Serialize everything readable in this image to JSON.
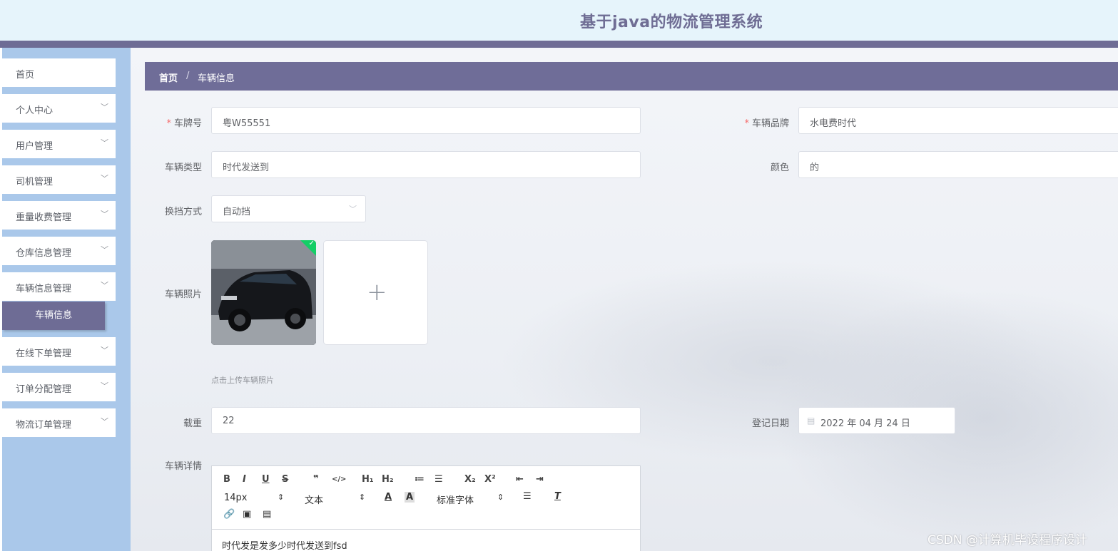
{
  "app_title": "基于java的物流管理系统",
  "sidebar": {
    "items": [
      {
        "label": "首页"
      },
      {
        "label": "个人中心"
      },
      {
        "label": "用户管理"
      },
      {
        "label": "司机管理"
      },
      {
        "label": "重量收费管理"
      },
      {
        "label": "仓库信息管理"
      },
      {
        "label": "车辆信息管理"
      },
      {
        "label": "在线下单管理"
      },
      {
        "label": "订单分配管理"
      },
      {
        "label": "物流订单管理"
      }
    ],
    "active_sub": "车辆信息"
  },
  "breadcrumb": {
    "home": "首页",
    "separator": "/",
    "current": "车辆信息"
  },
  "form": {
    "plate": {
      "label": "车牌号",
      "value": "粤W55551",
      "required": "*"
    },
    "brand": {
      "label": "车辆品牌",
      "value": "水电费时代",
      "required": "*"
    },
    "type": {
      "label": "车辆类型",
      "value": "时代发送到"
    },
    "color": {
      "label": "颜色",
      "value": "的"
    },
    "gear": {
      "label": "换挡方式",
      "value": "自动挡"
    },
    "photo": {
      "label": "车辆照片",
      "tip": "点击上传车辆照片",
      "add": "+"
    },
    "load": {
      "label": "载重",
      "value": "22"
    },
    "date": {
      "label": "登记日期",
      "value": "2022 年 04 月 24 日"
    },
    "detail": {
      "label": "车辆详情",
      "content": "时代发是发多少时代发送到fsd"
    }
  },
  "editor": {
    "row1": [
      "B",
      "I",
      "U",
      "S",
      "❞",
      "</>",
      "H₁",
      "H₂",
      "≔",
      "☰",
      "X₂",
      "X²",
      "⇤",
      "⇥"
    ],
    "font_size": "14px",
    "text_style": "文本",
    "font_family": "标准字体",
    "arrow": "⇕"
  },
  "watermark": "CSDN @计算机毕设程序设计",
  "colors": {
    "accent": "#6e6c95",
    "sidebar": "#aac8ea",
    "header": "#e6f4fb"
  }
}
